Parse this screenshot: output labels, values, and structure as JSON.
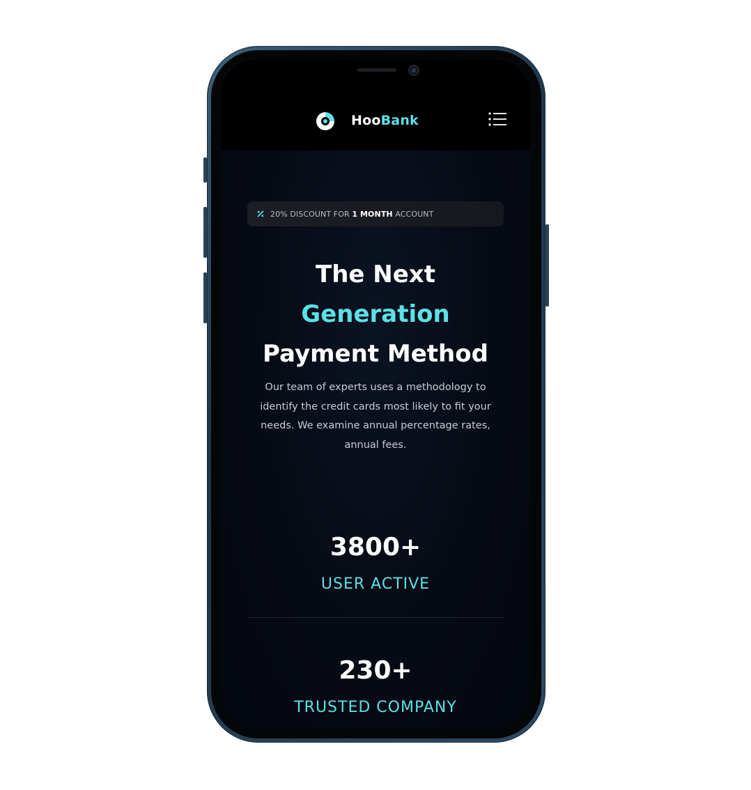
{
  "brand": {
    "name_part1": "Hoo",
    "name_part2": "Bank",
    "accent_color": "#5ce1e6",
    "logo_icon": "hoobank-logo-icon"
  },
  "nav": {
    "menu_icon": "hamburger-menu-icon"
  },
  "hero": {
    "discount": {
      "icon": "discount-percent-icon",
      "prefix": "20% DISCOUNT FOR",
      "highlight": "1 MONTH",
      "suffix": "ACCOUNT"
    },
    "title_line1": "The Next",
    "title_line2": "Generation",
    "title_line3": "Payment Method",
    "description": "Our team of experts uses a methodology to identify the credit cards most likely to fit your needs. We examine annual percentage rates, annual fees."
  },
  "stats": [
    {
      "value": "3800+",
      "label": "USER ACTIVE"
    },
    {
      "value": "230+",
      "label": "TRUSTED COMPANY"
    }
  ],
  "colors": {
    "background": "#04070f",
    "text_primary": "#ffffff",
    "text_secondary": "#c8cbd2",
    "frame": "#2c4a62"
  }
}
